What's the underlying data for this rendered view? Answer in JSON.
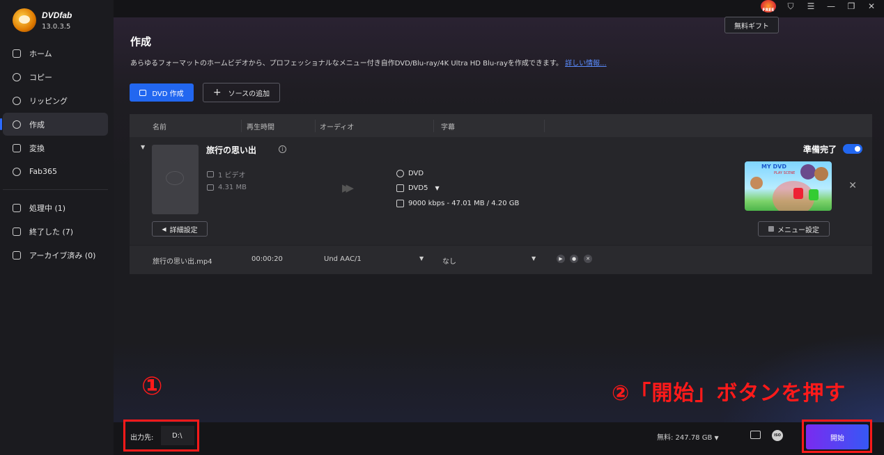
{
  "app": {
    "name": "DVDfab",
    "version": "13.0.3.5"
  },
  "sidebar": {
    "items": [
      {
        "label": "ホーム",
        "icon": "home-icon"
      },
      {
        "label": "コピー",
        "icon": "copy-icon"
      },
      {
        "label": "リッピング",
        "icon": "ripper-icon"
      },
      {
        "label": "作成",
        "icon": "creator-icon",
        "active": true
      },
      {
        "label": "変換",
        "icon": "converter-icon"
      },
      {
        "label": "Fab365",
        "icon": "fab365-icon"
      }
    ],
    "queue": [
      {
        "label": "処理中 (1)",
        "icon": "processing-icon"
      },
      {
        "label": "終了した (7)",
        "icon": "finished-icon"
      },
      {
        "label": "アーカイブ済み (0)",
        "icon": "archive-icon"
      }
    ]
  },
  "topbar": {
    "free_badge": "FREE",
    "gift_label": "無料ギフト"
  },
  "main": {
    "title": "作成",
    "description": "あらゆるフォーマットのホームビデオから、プロフェッショナルなメニュー付き自作DVD/Blu-ray/4K Ultra HD Blu-rayを作成できます。",
    "details_link": "詳しい情報...",
    "dvd_button": "DVD 作成",
    "add_source_button": "ソースの追加"
  },
  "table": {
    "headers": [
      "名前",
      "再生時間",
      "オーディオ",
      "字幕"
    ],
    "item": {
      "title": "旅行の思い出",
      "video_count": "1 ビデオ",
      "size": "4.31 MB",
      "output_format": "DVD",
      "disc_type": "DVD5",
      "bitrate_info": "9000 kbps - 47.01 MB / 4.20 GB",
      "status": "準備完了",
      "ready_toggle": true,
      "menu_preview_title": "MY DVD",
      "menu_preview_subtitle": "PLAY\nSCENE",
      "detail_button": "詳細設定",
      "menu_button": "メニュー設定"
    },
    "file": {
      "name": "旅行の思い出.mp4",
      "duration": "00:00:20",
      "audio": "Und  AAC/1",
      "subtitle": "なし"
    }
  },
  "annotations": {
    "step1": "①",
    "step2": "②「開始」ボタンを押す"
  },
  "bottom": {
    "output_label": "出力先:",
    "output_path": "D:\\",
    "free_space": "無料: 247.78 GB",
    "iso_label": "ISO",
    "start_button": "開始"
  },
  "colors": {
    "accent": "#2267f0",
    "annotation": "#ff1a1a",
    "start_gradient_from": "#7a2bf0",
    "start_gradient_to": "#3658f5"
  }
}
